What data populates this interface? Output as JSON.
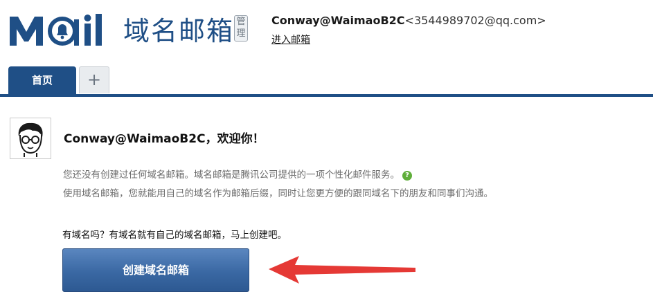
{
  "header": {
    "logo_text": "Mail",
    "product_name": "域名邮箱",
    "admin_badge": "管理",
    "account_name": "Conway@WaimaoB2C",
    "account_email": "<3544989702@qq.com>",
    "enter_mailbox_link": "进入邮箱"
  },
  "tabs": {
    "home_label": "首页",
    "add_label": "+"
  },
  "main": {
    "welcome_text": "Conway@WaimaoB2C，欢迎你！",
    "intro_line1": "您还没有创建过任何域名邮箱。域名邮箱是腾讯公司提供的一项个性化邮件服务。",
    "intro_line2": "使用域名邮箱，您就能用自己的域名作为邮箱后缀，同时让您更方便的跟同域名下的朋友和同事们沟通。",
    "help_icon": "?",
    "question_text": "有域名吗？有域名就有自己的域名邮箱，马上创建吧。",
    "create_button_label": "创建域名邮箱"
  },
  "icons": {
    "help": "question-circle-icon",
    "arrow": "red-arrow-annotation"
  },
  "colors": {
    "brand_blue": "#1f4f86",
    "button_blue": "#3a68a3",
    "annotation_red": "#e53935",
    "help_green": "#5fae3a"
  }
}
